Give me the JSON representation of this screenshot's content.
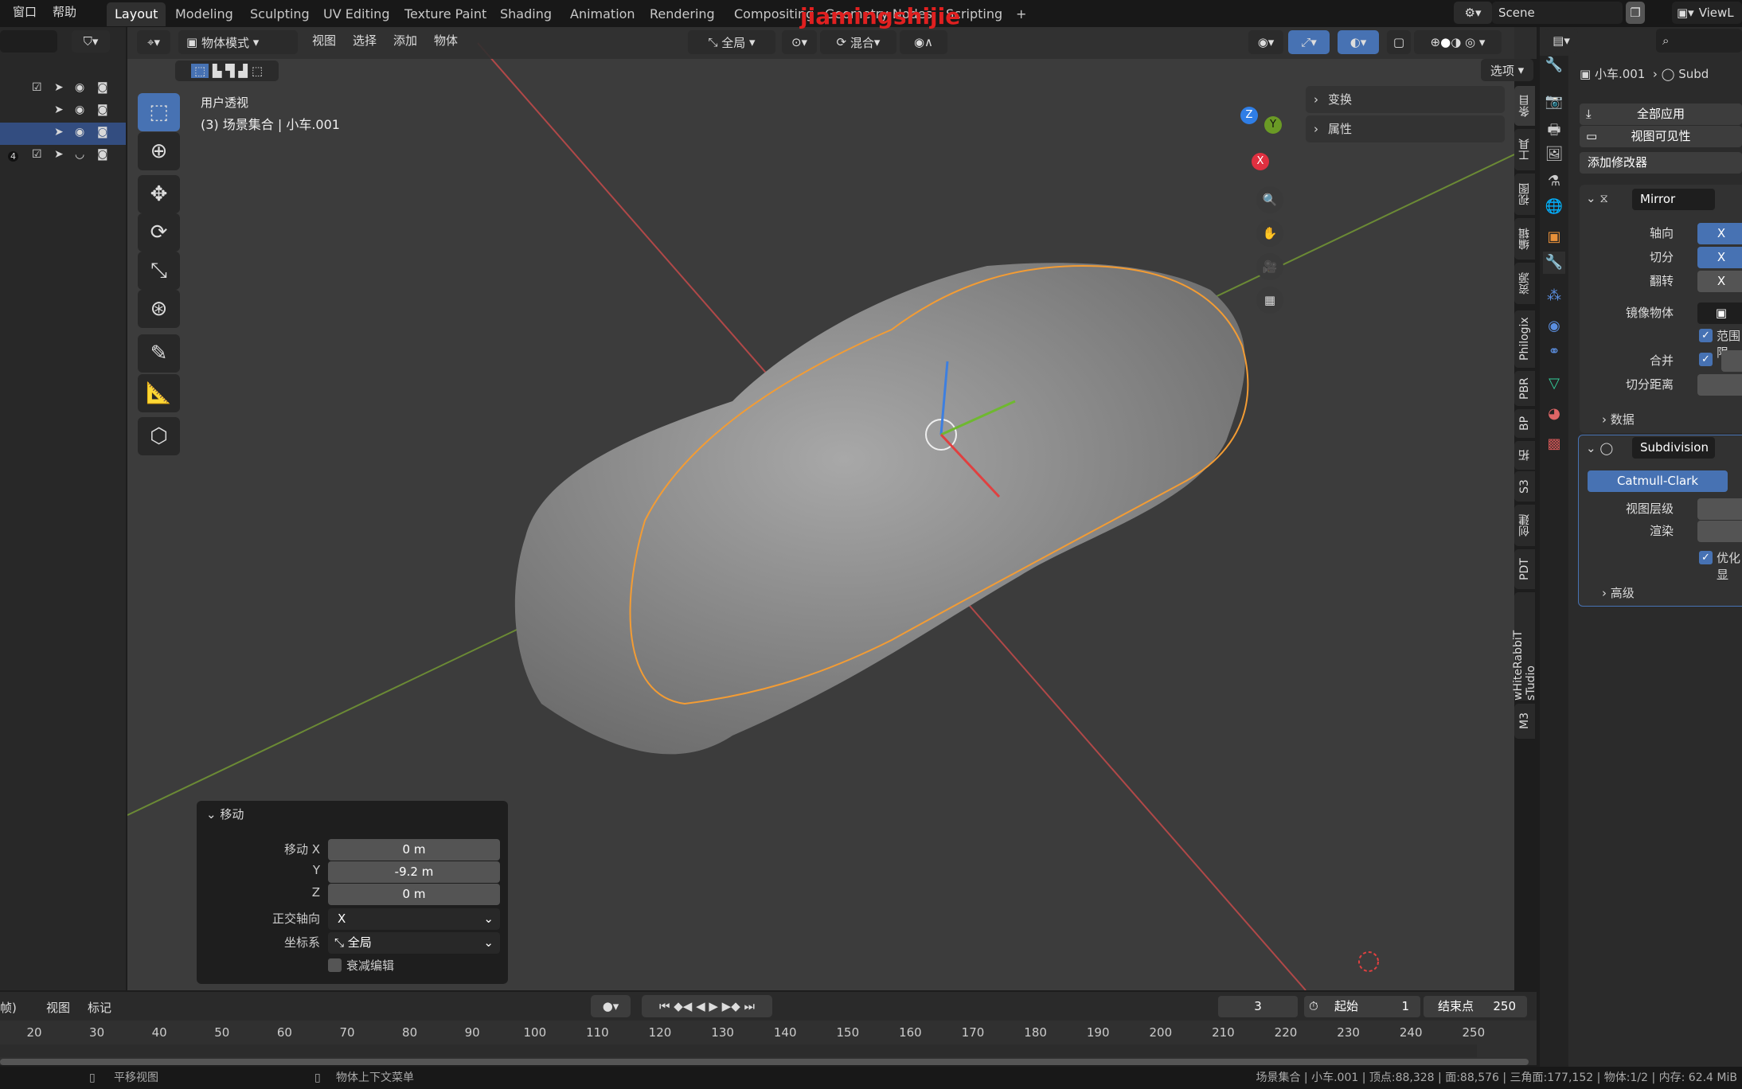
{
  "topbar": {
    "menus": [
      "窗口",
      "帮助"
    ],
    "workspaces": [
      "Layout",
      "Modeling",
      "Sculpting",
      "UV Editing",
      "Texture Paint",
      "Shading",
      "Animation",
      "Rendering",
      "Compositing",
      "Geometry Nodes",
      "Scripting"
    ],
    "active_workspace": "Layout",
    "add_tab": "+",
    "scene": "Scene",
    "view_layer": "ViewL",
    "watermark": "jiamingshijie"
  },
  "viewport": {
    "mode": "物体模式",
    "menus": [
      "视图",
      "选择",
      "添加",
      "物体"
    ],
    "orientation": "全局",
    "snap": "混合",
    "options": "选项",
    "view_name": "用户透视",
    "object_info": "(3) 场景集合 | 小车.001",
    "gizmo_axes": [
      "X",
      "Y",
      "Z"
    ],
    "colors": {
      "x_axis": "#c84a4a",
      "y_axis": "#7a9a3a",
      "selection": "#f39c34",
      "blue": "#4772b3"
    }
  },
  "npanel": {
    "sections": [
      "变换",
      "属性"
    ],
    "tabs": [
      "条目",
      "工具",
      "视图",
      "编辑",
      "资源",
      "Philogix",
      "PBR",
      "BP",
      "拓",
      "S3",
      "创建",
      "PDT",
      "wHiteRabbiT sTudio",
      "M3"
    ],
    "active_tab": "条目"
  },
  "redo": {
    "title": "移动",
    "move_x_label": "移动 X",
    "move_x": "0 m",
    "y_label": "Y",
    "move_y": "-9.2 m",
    "z_label": "Z",
    "move_z": "0 m",
    "axis_label": "正交轴向",
    "axis": "X",
    "coord_label": "坐标系",
    "coord": "全局",
    "proportional": "衰减编辑"
  },
  "properties": {
    "breadcrumb_object": "小车.001",
    "breadcrumb_modifier": "Subd",
    "apply_all": "全部应用",
    "viewport_vis": "视图可见性",
    "add_modifier": "添加修改器",
    "mirror": {
      "name": "Mirror",
      "axis_label": "轴向",
      "axis": "X",
      "bisect_label": "切分",
      "bisect": "X",
      "flip_label": "翻转",
      "flip": "X",
      "mirror_obj_label": "镜像物体",
      "clipping": "范围限",
      "merge_label": "合并",
      "bisect_dist_label": "切分距离",
      "data": "数据"
    },
    "subdivision": {
      "name": "Subdivision",
      "type": "Catmull-Clark",
      "levels_label": "视图层级",
      "render_label": "渲染",
      "optimal": "优化显",
      "advanced": "高级"
    },
    "icons": [
      "tool-icon",
      "render-icon",
      "output-icon",
      "view-layer-icon",
      "scene-icon",
      "world-icon",
      "object-icon",
      "modifier-icon",
      "particles-icon",
      "physics-icon",
      "constraints-icon",
      "data-icon",
      "material-icon",
      "texture-icon"
    ]
  },
  "timeline": {
    "menus": [
      "帧)",
      "视图",
      "标记"
    ],
    "current_frame": "3",
    "start_label": "起始",
    "start": "1",
    "end_label": "结束点",
    "end": "250",
    "ticks": [
      "20",
      "30",
      "40",
      "50",
      "60",
      "70",
      "80",
      "90",
      "100",
      "110",
      "120",
      "130",
      "140",
      "150",
      "160",
      "170",
      "180",
      "190",
      "200",
      "210",
      "220",
      "230",
      "240",
      "250"
    ]
  },
  "status": {
    "left1": "平移视图",
    "left2": "物体上下文菜单",
    "right": "场景集合 | 小车.001 | 顶点:88,328 | 面:88,576 | 三角面:177,152 | 物体:1/2 | 内存: 62.4 MiB"
  },
  "outliner": {
    "badge": "4"
  }
}
